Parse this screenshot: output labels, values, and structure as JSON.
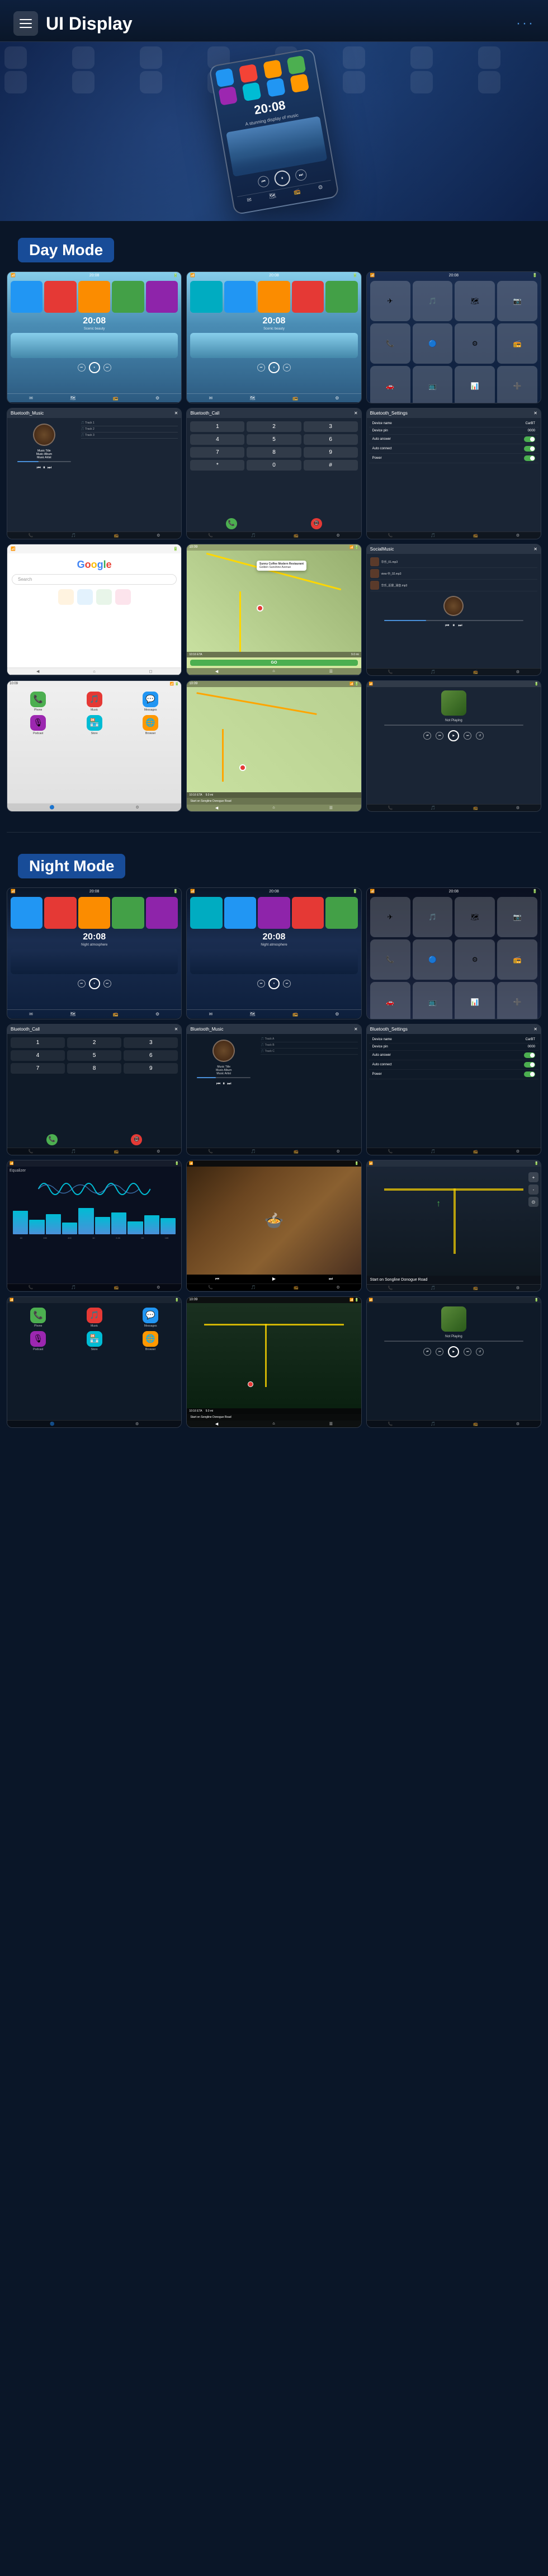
{
  "header": {
    "title": "UI Display",
    "menu_icon_label": "menu",
    "dots_icon": "···"
  },
  "day_mode": {
    "label": "Day Mode"
  },
  "night_mode": {
    "label": "Night Mode"
  },
  "screens": {
    "time": "20:08",
    "bluetooth_music": "Bluetooth_Music",
    "bluetooth_call": "Bluetooth_Call",
    "bluetooth_settings": "Bluetooth_Settings",
    "music_title": "Music Title",
    "music_album": "Music Album",
    "music_artist": "Music Artist",
    "device_name_label": "Device name",
    "device_name_value": "CarBT",
    "device_pin_label": "Device pin",
    "device_pin_value": "0000",
    "auto_answer_label": "Auto answer",
    "auto_connect_label": "Auto connect",
    "power_label": "Power",
    "google_placeholder": "Search",
    "restaurant_name": "Sunny Coffee Modern Restaurant",
    "restaurant_address": "Golden Sunshine Avenue",
    "social_music_title": "SocialMusic",
    "now_playing_label": "Not Playing",
    "eta_label": "10:16 ETA",
    "distance_label": "9.0 mi",
    "direction_label": "Start on Songline Donogue Road",
    "go_label": "GO",
    "time_bottom": "10:16 ETA"
  },
  "colors": {
    "accent": "#4a90d9",
    "bg_dark": "#0a1628",
    "bg_medium": "#1a2d50",
    "green": "#4CAF50",
    "red": "#e53935"
  },
  "app_icons": {
    "home_row1": [
      "📱",
      "🎵",
      "📷",
      "🗺",
      "⚙"
    ],
    "home_row2": [
      "📞",
      "📧",
      "📻",
      "🎮",
      "🔵"
    ],
    "home_row3": [
      "🌐",
      "📁",
      "🎬",
      "🔊",
      "📡"
    ]
  }
}
